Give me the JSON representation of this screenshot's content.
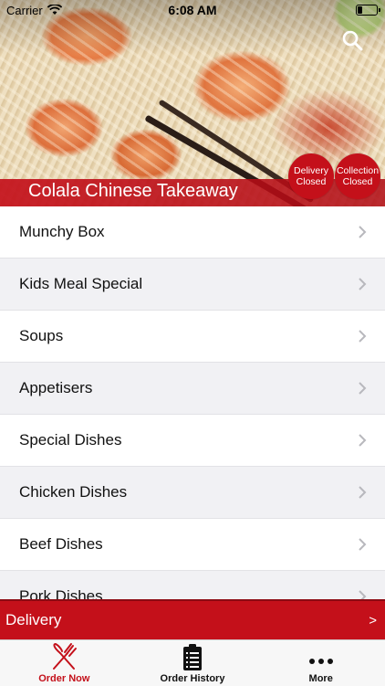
{
  "status_bar": {
    "carrier": "Carrier",
    "time": "6:08 AM",
    "battery_level": 0.3
  },
  "header": {
    "store_name": "Colala Chinese Takeaway",
    "search_icon": "search-icon",
    "delivery_badge": {
      "line1": "Delivery",
      "line2": "Closed"
    },
    "collection_badge": {
      "line1": "Collection",
      "line2": "Closed"
    }
  },
  "menu": {
    "items": [
      {
        "label": "Munchy Box"
      },
      {
        "label": "Kids Meal Special"
      },
      {
        "label": "Soups"
      },
      {
        "label": "Appetisers"
      },
      {
        "label": "Special Dishes"
      },
      {
        "label": "Chicken Dishes"
      },
      {
        "label": "Beef Dishes"
      },
      {
        "label": "Pork Dishes"
      }
    ]
  },
  "order_bar": {
    "label": "Delivery",
    "arrow": ">"
  },
  "tabs": [
    {
      "label": "Order Now",
      "icon": "fork-knife-icon",
      "active": true
    },
    {
      "label": "Order History",
      "icon": "clipboard-icon",
      "active": false
    },
    {
      "label": "More",
      "icon": "more-dots-icon",
      "active": false
    }
  ],
  "colors": {
    "brand_red": "#c4101a",
    "row_alt": "#f1f1f4",
    "tab_bg": "#f7f7f7"
  }
}
